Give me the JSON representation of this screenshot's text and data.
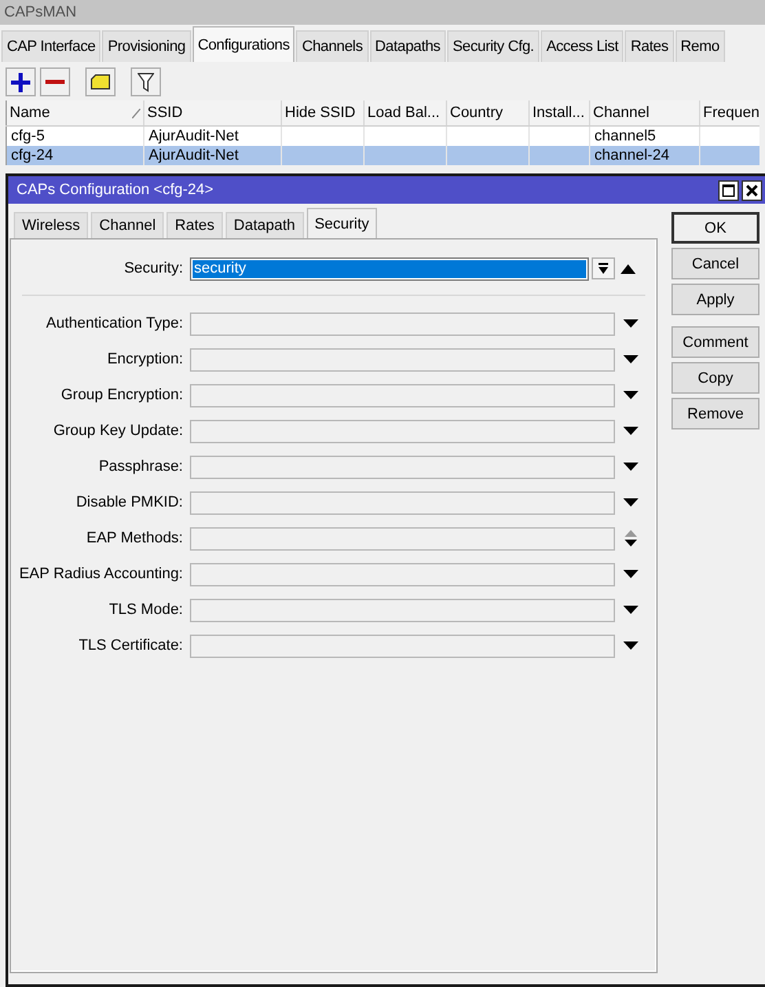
{
  "window": {
    "title": "CAPsMAN"
  },
  "tabs": [
    {
      "label": "CAP Interface",
      "selected": false
    },
    {
      "label": "Provisioning",
      "selected": false
    },
    {
      "label": "Configurations",
      "selected": true
    },
    {
      "label": "Channels",
      "selected": false
    },
    {
      "label": "Datapaths",
      "selected": false
    },
    {
      "label": "Security Cfg.",
      "selected": false
    },
    {
      "label": "Access List",
      "selected": false
    },
    {
      "label": "Rates",
      "selected": false
    },
    {
      "label": "Remo",
      "selected": false
    }
  ],
  "table": {
    "columns": [
      "Name",
      "SSID",
      "Hide SSID",
      "Load Bal...",
      "Country",
      "Install...",
      "Channel",
      "Frequen"
    ],
    "rows": [
      {
        "cells": [
          "cfg-5",
          "AjurAudit-Net",
          "",
          "",
          "",
          "",
          "channel5",
          ""
        ],
        "selected": false
      },
      {
        "cells": [
          "cfg-24",
          "AjurAudit-Net",
          "",
          "",
          "",
          "",
          "channel-24",
          ""
        ],
        "selected": true
      }
    ]
  },
  "dialog": {
    "title": "CAPs Configuration <cfg-24>",
    "tabs": [
      {
        "label": "Wireless",
        "selected": false
      },
      {
        "label": "Channel",
        "selected": false
      },
      {
        "label": "Rates",
        "selected": false
      },
      {
        "label": "Datapath",
        "selected": false
      },
      {
        "label": "Security",
        "selected": true
      }
    ],
    "security": {
      "label": "Security:",
      "value": "security",
      "selected": true
    },
    "fields": [
      {
        "label": "Authentication Type:",
        "kind": "dropdown"
      },
      {
        "label": "Encryption:",
        "kind": "dropdown"
      },
      {
        "label": "Group Encryption:",
        "kind": "dropdown"
      },
      {
        "label": "Group Key Update:",
        "kind": "dropdown"
      },
      {
        "label": "Passphrase:",
        "kind": "dropdown"
      },
      {
        "label": "Disable PMKID:",
        "kind": "dropdown"
      },
      {
        "label": "EAP Methods:",
        "kind": "updown"
      },
      {
        "label": "EAP Radius Accounting:",
        "kind": "dropdown"
      },
      {
        "label": "TLS Mode:",
        "kind": "dropdown"
      },
      {
        "label": "TLS Certificate:",
        "kind": "dropdown"
      }
    ],
    "button_groups": [
      [
        {
          "label": "OK",
          "default": true
        },
        {
          "label": "Cancel",
          "default": false
        },
        {
          "label": "Apply",
          "default": false
        }
      ],
      [
        {
          "label": "Comment",
          "default": false
        },
        {
          "label": "Copy",
          "default": false
        },
        {
          "label": "Remove",
          "default": false
        }
      ]
    ]
  }
}
